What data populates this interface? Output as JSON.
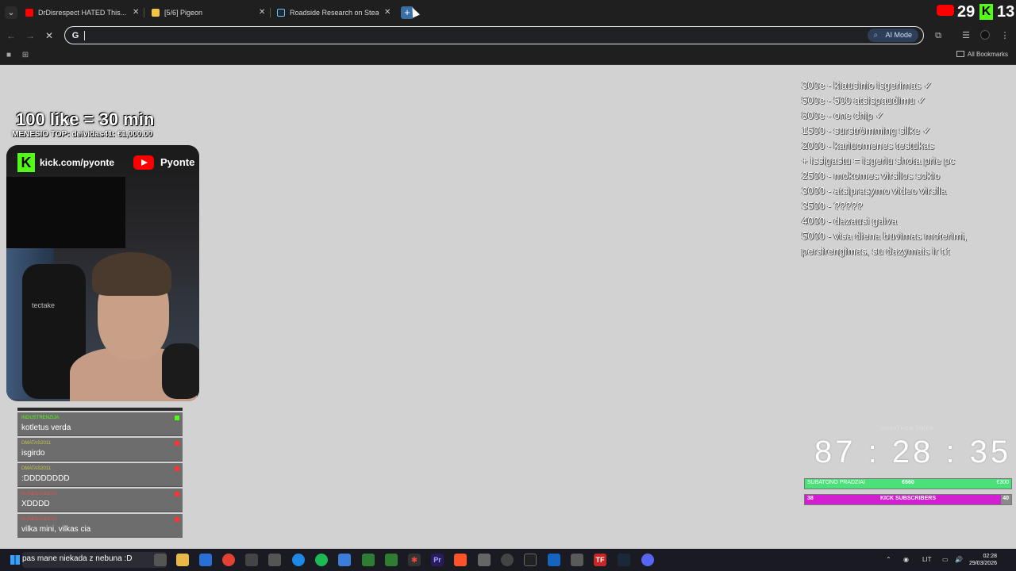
{
  "browser": {
    "tabs": [
      {
        "title": "DrDisrespect HATED This... Now",
        "favicon_color": "#ff0000"
      },
      {
        "title": "[5/6] Pigeon",
        "favicon_color": "#f4c542"
      },
      {
        "title": "Roadside Research on Steam",
        "favicon_color": "#1b2838"
      }
    ],
    "omnibox": {
      "value": "",
      "search_icon": "G",
      "ai_mode_label": "AI Mode"
    },
    "bookmarks": {
      "all_label": "All Bookmarks"
    }
  },
  "stream_stats": {
    "youtube_count": "29",
    "kick_count": "13"
  },
  "overlay": {
    "likes_title": "100 like = 30 min",
    "top_donor": "MENESIO TOP: deividas41: €1,000.00",
    "kick_url": "kick.com/pyonte",
    "youtube_name": "Pyonte",
    "cam_brand": "tectake"
  },
  "chat": [
    {
      "user": "INDUSTRENZIJA",
      "user_color": "#53fc18",
      "badge_color": "#53fc18",
      "text": "kotletus verda"
    },
    {
      "user": "DMATAS2011",
      "user_color": "#c8c850",
      "badge_color": "#ff3333",
      "text": "isgirdo"
    },
    {
      "user": "DMATAS2011",
      "user_color": "#c8c850",
      "badge_color": "#ff3333",
      "text": ":DDDDDDDD"
    },
    {
      "user": "KUNEGALEXAS",
      "user_color": "#e05050",
      "badge_color": "#ff3333",
      "text": "XDDDD"
    },
    {
      "user": "KUNEGALEXAS",
      "user_color": "#e05050",
      "badge_color": "#ff3333",
      "text": "vilka mini, vilkas cia"
    }
  ],
  "goals": [
    "300e - kiausinio isgerimas ✓",
    "500e - 500 atsispaudimu ✓",
    "800e - one chip ✓",
    "1500 - surströmming silke ✓",
    "2000 - kariuomenes testukas",
    "+ issigastu = isgeriu shota prie pc",
    "2500 - mokomes virsilos sokio",
    "3000 - atsiprasymo video virsila",
    "3500 - ?????",
    "4000 - dazausi galva",
    "5000 - visa diena buvimas moterimi,",
    "persirengimas, su dazymais ir t.t"
  ],
  "timer": {
    "label": "SUBATHON TIMER",
    "value": "87 : 28 : 35"
  },
  "bars": {
    "saturday": {
      "label": "SUBATONO PRADZIAI",
      "current": "€660",
      "target": "€300",
      "fill_fraction": 1.0,
      "color": "#4be07a"
    },
    "kick": {
      "label": "KICK SUBSCRIBERS",
      "current": "38",
      "target": "40",
      "fill_fraction": 0.95,
      "color": "#d11fd1"
    }
  },
  "taskbar": {
    "search_text": "pas mane niekada z nebuna :D",
    "language": "LIT",
    "time": "02:28",
    "date": "29/03/2026"
  }
}
